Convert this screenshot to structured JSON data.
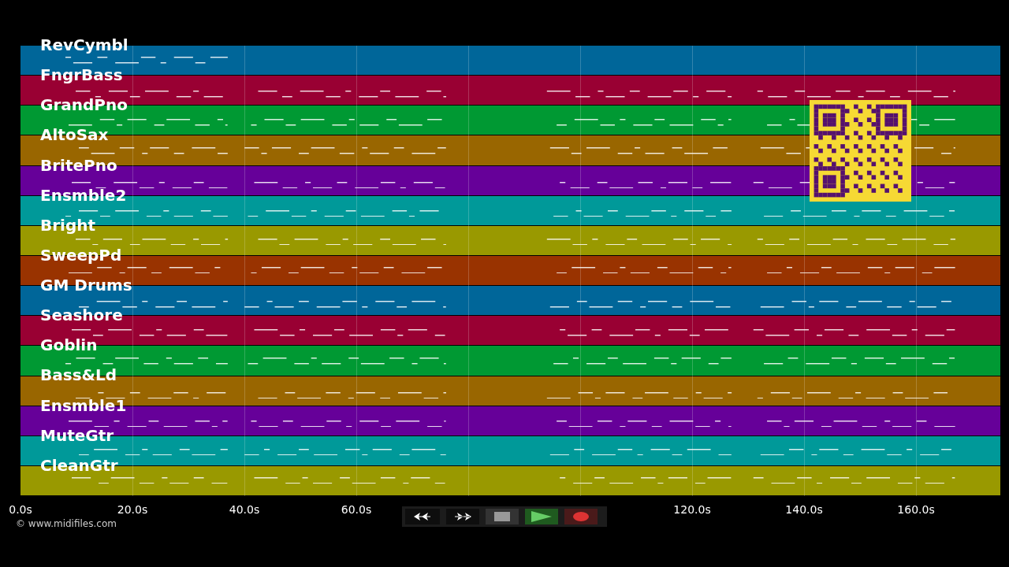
{
  "tracks": [
    {
      "name": "RevCymbl",
      "color": "#006699"
    },
    {
      "name": "FngrBass",
      "color": "#990033"
    },
    {
      "name": "GrandPno",
      "color": "#009933"
    },
    {
      "name": "AltoSax",
      "color": "#996600"
    },
    {
      "name": "BritePno",
      "color": "#660099"
    },
    {
      "name": "Ensmble2",
      "color": "#009999"
    },
    {
      "name": "Bright",
      "color": "#999900"
    },
    {
      "name": "SweepPd",
      "color": "#993300"
    },
    {
      "name": "GM Drums",
      "color": "#006699"
    },
    {
      "name": "Seashore",
      "color": "#990033"
    },
    {
      "name": "Goblin",
      "color": "#009933"
    },
    {
      "name": "Bass&Ld",
      "color": "#996600"
    },
    {
      "name": "Ensmble1",
      "color": "#660099"
    },
    {
      "name": "MuteGtr",
      "color": "#009999"
    },
    {
      "name": "CleanGtr",
      "color": "#999900"
    }
  ],
  "time_axis": [
    "0.0s",
    "20.0s",
    "40.0s",
    "60.0s",
    "120.0s",
    "140.0s",
    "160.0s"
  ],
  "credit": "© www.midifiles.com"
}
